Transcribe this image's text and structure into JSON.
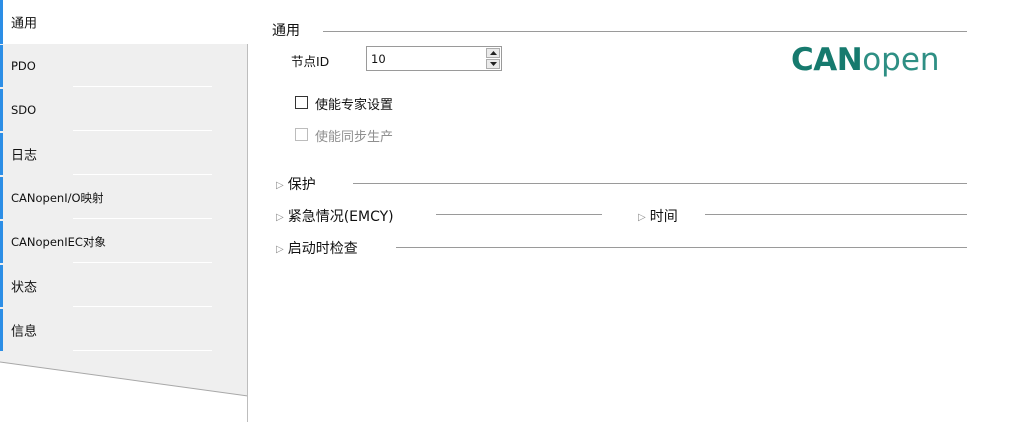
{
  "tabs": [
    {
      "label": "通用",
      "active": true
    },
    {
      "label": "PDO",
      "active": false
    },
    {
      "label": "SDO",
      "active": false
    },
    {
      "label": "日志",
      "active": false
    },
    {
      "label": "CANopenI/O映射",
      "active": false
    },
    {
      "label": "CANopenIEC对象",
      "active": false
    },
    {
      "label": "状态",
      "active": false
    },
    {
      "label": "信息",
      "active": false
    }
  ],
  "general": {
    "title": "通用",
    "node_id_label": "节点ID",
    "node_id_value": "10",
    "logo_bold": "CAN",
    "logo_thin": "open",
    "enable_expert_label": "使能专家设置",
    "enable_expert_checked": false,
    "enable_sync_label": "使能同步生产",
    "enable_sync_checked": false,
    "enable_sync_disabled": true
  },
  "sections": {
    "protection": "保护",
    "emergency": "紧急情况(EMCY)",
    "time": "时间",
    "startup_check": "启动时检查"
  },
  "colors": {
    "accent": "#2c8ee6",
    "logo_bold": "#167a6e",
    "logo_thin": "#2e8f84",
    "panel_bg": "#efefef"
  }
}
